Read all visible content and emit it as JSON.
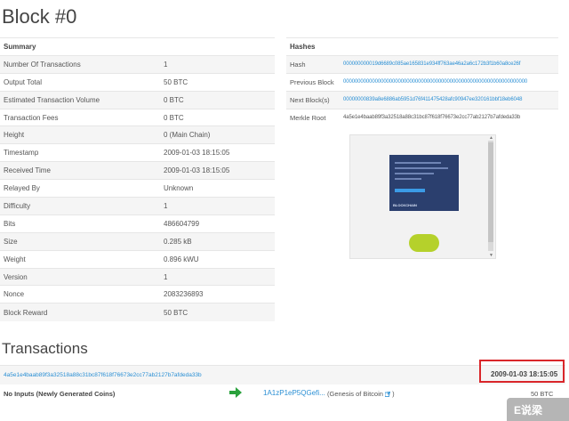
{
  "page": {
    "title": "Block #0"
  },
  "summary": {
    "header": "Summary",
    "rows": [
      {
        "label": "Number Of Transactions",
        "value": "1"
      },
      {
        "label": "Output Total",
        "value": "50 BTC"
      },
      {
        "label": "Estimated Transaction Volume",
        "value": "0 BTC"
      },
      {
        "label": "Transaction Fees",
        "value": "0 BTC"
      },
      {
        "label": "Height",
        "value": "0 (Main Chain)"
      },
      {
        "label": "Timestamp",
        "value": "2009-01-03 18:15:05"
      },
      {
        "label": "Received Time",
        "value": "2009-01-03 18:15:05"
      },
      {
        "label": "Relayed By",
        "value": "Unknown"
      },
      {
        "label": "Difficulty",
        "value": "1"
      },
      {
        "label": "Bits",
        "value": "486604799"
      },
      {
        "label": "Size",
        "value": "0.285 kB"
      },
      {
        "label": "Weight",
        "value": "0.896 kWU"
      },
      {
        "label": "Version",
        "value": "1"
      },
      {
        "label": "Nonce",
        "value": "2083236893"
      },
      {
        "label": "Block Reward",
        "value": "50 BTC"
      }
    ]
  },
  "hashes": {
    "header": "Hashes",
    "rows": [
      {
        "label": "Hash",
        "value": "000000000019d6689c085ae165831e934ff763ae46a2a6c172b3f1b60a8ce26f"
      },
      {
        "label": "Previous Block",
        "value": "0000000000000000000000000000000000000000000000000000000000000000"
      },
      {
        "label": "Next Block(s)",
        "value": "00000000839a8e6886ab5951d76f411475428afc90947ee320161bbf18eb6048"
      },
      {
        "label": "Merkle Root",
        "value": "4a5e1e4baab89f3a32518a88c31bc87f618f76673e2cc77ab2127b7afdeda33b"
      }
    ]
  },
  "ad": {
    "brand": "BLOCKCHAIN"
  },
  "transactions": {
    "title": "Transactions",
    "hash": "4a5e1e4baab89f3a32518a88c31bc87f618f76673e2cc77ab2127b7afdeda33b",
    "time": "2009-01-03 18:15:05",
    "inputs": "No Inputs (Newly Generated Coins)",
    "address": "1A1zP1eP5QGefi...",
    "note": "(Genesis of Bitcoin",
    "amount": "50 BTC"
  },
  "watermark": {
    "text": "E说梁"
  },
  "colors": {
    "link": "#2a8fd4",
    "green": "#2aa13c",
    "highlight": "#d9262a"
  },
  "icons": {
    "arrow": "arrow-right-icon",
    "external": "external-link-icon"
  }
}
